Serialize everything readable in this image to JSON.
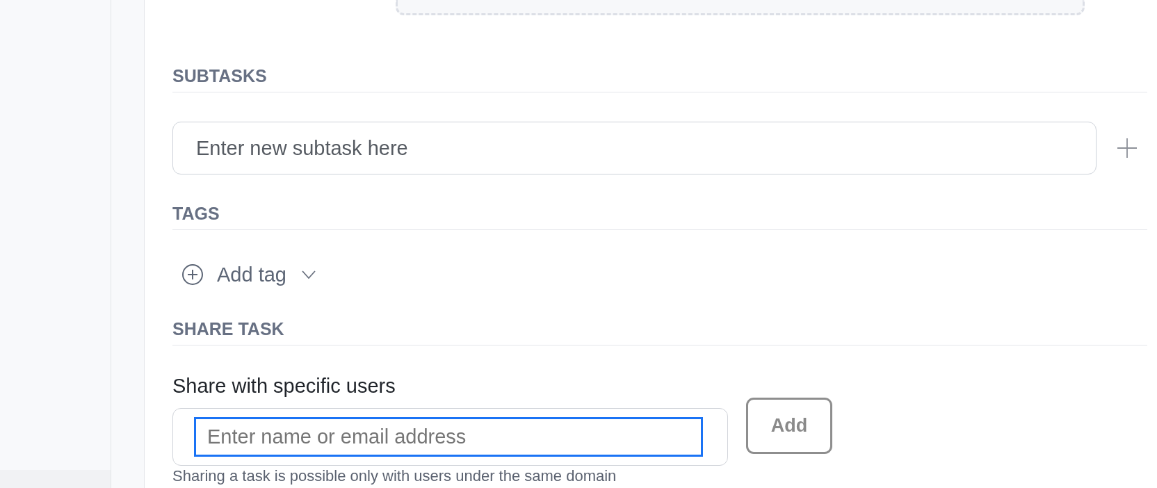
{
  "sections": [
    {
      "kind": "subtasks",
      "heading": "SUBTASKS",
      "input": {
        "placeholder": "Enter new subtask here"
      }
    },
    {
      "kind": "tags",
      "heading": "TAGS",
      "add_tag": {
        "label": "Add tag"
      }
    },
    {
      "kind": "share",
      "heading": "SHARE TASK",
      "label": "Share with specific users",
      "input": {
        "placeholder": "Enter name or email address",
        "focused": true
      },
      "add_button": {
        "label": "Add",
        "disabled": true
      },
      "hint": "Sharing a task is possible only with users under the same domain"
    }
  ]
}
